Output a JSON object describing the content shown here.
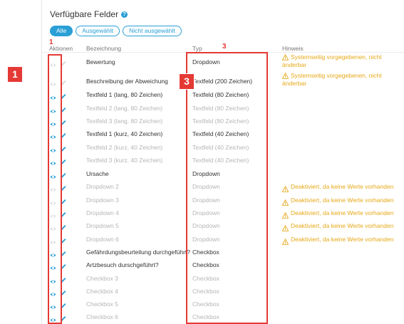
{
  "panel": {
    "title": "Verfügbare Felder",
    "filters": [
      {
        "label": "Alle",
        "active": true
      },
      {
        "label": "Ausgewählt",
        "active": false
      },
      {
        "label": "Nicht ausgewählt",
        "active": false
      }
    ]
  },
  "columns": {
    "aktionen": "Aktionen",
    "bezeichnung": "Bezeichnung",
    "typ": "Typ",
    "hinweis": "Hinweis"
  },
  "hints": {
    "system_line1": "Systemseitig vorgegebenen, nicht",
    "system_line2": "änderbar",
    "deactivated": "Deaktiviert, da keine Werte vorhanden"
  },
  "rows": [
    {
      "name": "Bewertung",
      "type": "Dropdown",
      "enabled": true,
      "visible": false,
      "editable": false,
      "hint": "system"
    },
    {
      "name": "Beschreibung der Abweichung",
      "type": "Textfeld (200 Zeichen)",
      "enabled": true,
      "visible": false,
      "editable": false,
      "hint": "system"
    },
    {
      "name": "Textfeld 1 (lang, 80 Zeichen)",
      "type": "Textfeld (80 Zeichen)",
      "enabled": true,
      "visible": true,
      "editable": true,
      "hint": ""
    },
    {
      "name": "Textfeld 2 (lang, 80 Zeichen)",
      "type": "Textfeld (80 Zeichen)",
      "enabled": false,
      "visible": true,
      "editable": true,
      "hint": ""
    },
    {
      "name": "Textfeld 3 (lang, 80 Zeichen)",
      "type": "Textfeld (80 Zeichen)",
      "enabled": false,
      "visible": true,
      "editable": true,
      "hint": ""
    },
    {
      "name": "Textfeld 1 (kurz, 40 Zeichen)",
      "type": "Textfeld (40 Zeichen)",
      "enabled": true,
      "visible": true,
      "editable": true,
      "hint": ""
    },
    {
      "name": "Textfeld 2 (kurz, 40 Zeichen)",
      "type": "Textfeld (40 Zeichen)",
      "enabled": false,
      "visible": true,
      "editable": true,
      "hint": ""
    },
    {
      "name": "Textfeld 3 (kurz, 40 Zeichen)",
      "type": "Textfeld (40 Zeichen)",
      "enabled": false,
      "visible": true,
      "editable": true,
      "hint": ""
    },
    {
      "name": "Ursache",
      "type": "Dropdown",
      "enabled": true,
      "visible": true,
      "editable": true,
      "hint": ""
    },
    {
      "name": "Dropdown 2",
      "type": "Dropdown",
      "enabled": false,
      "visible": false,
      "editable": true,
      "hint": "deactivated"
    },
    {
      "name": "Dropdown 3",
      "type": "Dropdown",
      "enabled": false,
      "visible": false,
      "editable": true,
      "hint": "deactivated"
    },
    {
      "name": "Dropdown 4",
      "type": "Dropdown",
      "enabled": false,
      "visible": false,
      "editable": true,
      "hint": "deactivated"
    },
    {
      "name": "Dropdown 5",
      "type": "Dropdown",
      "enabled": false,
      "visible": false,
      "editable": true,
      "hint": "deactivated"
    },
    {
      "name": "Dropdown 6",
      "type": "Dropdown",
      "enabled": false,
      "visible": false,
      "editable": true,
      "hint": "deactivated"
    },
    {
      "name": "Gefährdungsbeurteilung durchgeführt?",
      "type": "Checkbox",
      "enabled": true,
      "visible": true,
      "editable": true,
      "hint": ""
    },
    {
      "name": "Artzbesuch durschgeführt?",
      "type": "Checkbox",
      "enabled": true,
      "visible": true,
      "editable": true,
      "hint": ""
    },
    {
      "name": "Checkbox 3",
      "type": "Checkbox",
      "enabled": false,
      "visible": true,
      "editable": true,
      "hint": ""
    },
    {
      "name": "Checkbox 4",
      "type": "Checkbox",
      "enabled": false,
      "visible": true,
      "editable": true,
      "hint": ""
    },
    {
      "name": "Checkbox 5",
      "type": "Checkbox",
      "enabled": false,
      "visible": true,
      "editable": true,
      "hint": ""
    },
    {
      "name": "Checkbox 6",
      "type": "Checkbox",
      "enabled": false,
      "visible": true,
      "editable": true,
      "hint": ""
    }
  ],
  "annotations": {
    "badge_1": "1",
    "badge_3": "3",
    "label_1": "1",
    "label_3": "3",
    "color": "#e53935"
  },
  "colors": {
    "accent": "#2a9fd6",
    "warning": "#e6a817",
    "disabled_text": "#b5b5b5"
  }
}
